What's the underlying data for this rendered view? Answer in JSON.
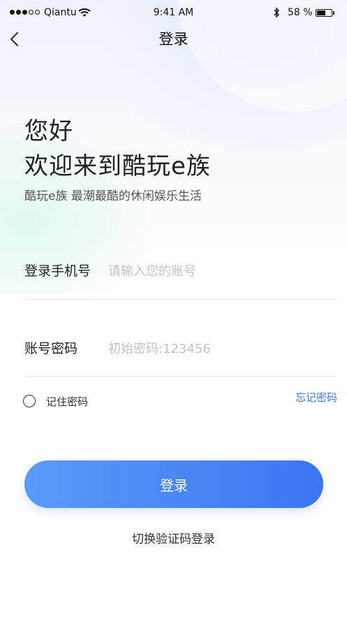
{
  "status_bar": {
    "carrier": "Qiantu",
    "time": "9:41 AM",
    "battery": "58 %",
    "battery_level": 0.58,
    "icons": [
      "signal-dots-icon",
      "wifi-icon",
      "bluetooth-icon",
      "battery-icon"
    ]
  },
  "nav": {
    "title": "登录",
    "back_icon": "chevron-left-icon"
  },
  "greeting": {
    "line1": "您好",
    "line2": "欢迎来到酷玩e族",
    "slogan": "酷玩e族  最潮最酷的休闲娱乐生活"
  },
  "form": {
    "phone": {
      "label": "登录手机号",
      "placeholder": "请输入您的账号",
      "value": ""
    },
    "password": {
      "label": "账号密码",
      "placeholder": "初始密码:123456",
      "value": ""
    },
    "remember_label": "记住密码",
    "remember_checked": false,
    "forgot_label": "忘记密码"
  },
  "actions": {
    "login_label": "登录",
    "switch_label": "切换验证码登录"
  },
  "colors": {
    "accent": "#3f7cf0",
    "button_start": "#5a9bf8",
    "button_end": "#3b74f2",
    "placeholder": "#c4c4c4"
  }
}
